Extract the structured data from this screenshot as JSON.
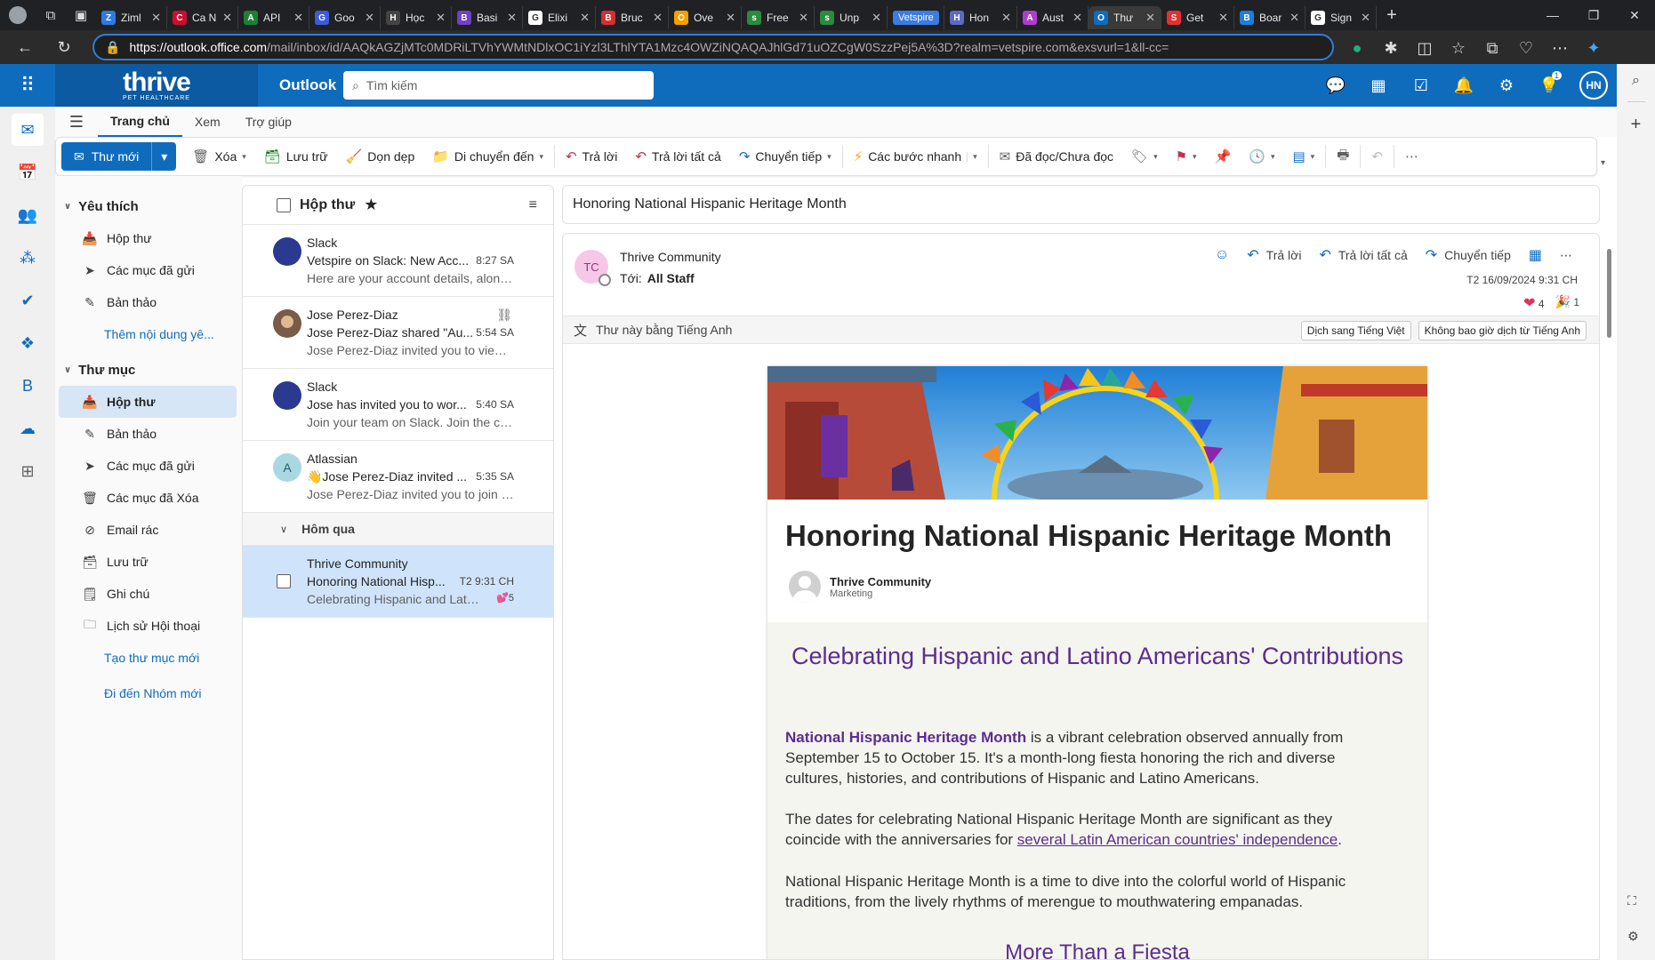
{
  "browser": {
    "tabs": [
      {
        "label": "Ziml",
        "color": "#2d7be0",
        "glyph": "Z"
      },
      {
        "label": "Ca N",
        "color": "#c8102e",
        "glyph": "C"
      },
      {
        "label": "API",
        "color": "#1e7e34",
        "glyph": "A"
      },
      {
        "label": "Goo",
        "color": "#3b5bdb",
        "glyph": "G"
      },
      {
        "label": "Học",
        "color": "#444",
        "glyph": "H"
      },
      {
        "label": "Basi",
        "color": "#6f42c1",
        "glyph": "B"
      },
      {
        "label": "Elixi",
        "color": "#fff",
        "glyph": "G"
      },
      {
        "label": "Bruc",
        "color": "#d32f2f",
        "glyph": "B"
      },
      {
        "label": "Ove",
        "color": "#f59f00",
        "glyph": "O"
      },
      {
        "label": "Free",
        "color": "#2b8a3e",
        "glyph": "s"
      },
      {
        "label": "Unp",
        "color": "#2b8a3e",
        "glyph": "s"
      },
      {
        "label": "Vetspire",
        "color": "#3b7ce0",
        "glyph": "Vetspire",
        "pill": true
      },
      {
        "label": "Hon",
        "color": "#5c6bc0",
        "glyph": "H"
      },
      {
        "label": "Aust",
        "color": "#ae3ec9",
        "glyph": "A"
      },
      {
        "label": "Thư",
        "color": "#0f6cbd",
        "glyph": "O",
        "active": true
      },
      {
        "label": "Get",
        "color": "#e03131",
        "glyph": "S"
      },
      {
        "label": "Boar",
        "color": "#1c7ed6",
        "glyph": "B"
      },
      {
        "label": "Sign",
        "color": "#fff",
        "glyph": "G"
      }
    ],
    "url_host": "https://outlook.office.com",
    "url_rest": "/mail/inbox/id/AAQkAGZjMTc0MDRiLTVhYWMtNDlxOC1iYzl3LThlYTA1Mzc4OWZiNQAQAJhlGd71uOZCgW0SzzPej5A%3D?realm=vetspire.com&exsvurl=1&ll-cc="
  },
  "header": {
    "brand": "thrive",
    "brand_sub": "PET HEALTHCARE",
    "app": "Outlook",
    "search_placeholder": "Tìm kiếm",
    "avatar": "HN",
    "badge": "1"
  },
  "ribbon": {
    "tabs": [
      "Trang chủ",
      "Xem",
      "Trợ giúp"
    ],
    "new_mail": "Thư mới",
    "delete": "Xóa",
    "archive": "Lưu trữ",
    "sweep": "Dọn dẹp",
    "move": "Di chuyển đến",
    "reply": "Trả lời",
    "reply_all": "Trả lời tất cả",
    "forward": "Chuyển tiếp",
    "quick_steps": "Các bước nhanh",
    "read_unread": "Đã đọc/Chưa đọc"
  },
  "folders": {
    "favorites_title": "Yêu thích",
    "favorites": [
      "Hộp thư",
      "Các mục đã gửi",
      "Bản thảo"
    ],
    "favorites_add": "Thêm nội dung yê...",
    "folders_title": "Thư mục",
    "items": [
      "Hộp thư",
      "Bản thảo",
      "Các mục đã gửi",
      "Các mục đã Xóa",
      "Email rác",
      "Lưu trữ",
      "Ghi chú",
      "Lịch sử Hội thoại"
    ],
    "new_folder": "Tạo thư mục mới",
    "new_group": "Đi đến Nhóm mới"
  },
  "messagelist": {
    "title": "Hộp thư",
    "messages": [
      {
        "sender": "Slack",
        "subject": "Vetspire on Slack: New Acc...",
        "time": "8:27 SA",
        "preview": "Here are your account details, along..."
      },
      {
        "sender": "Jose Perez-Diaz",
        "subject": "Jose Perez-Diaz shared \"Au...",
        "time": "5:54 SA",
        "preview": "Jose Perez-Diaz invited you to view ..."
      },
      {
        "sender": "Slack",
        "subject": "Jose has invited you to wor...",
        "time": "5:40 SA",
        "preview": "Join your team on Slack. Join the co..."
      },
      {
        "sender": "Atlassian",
        "avatar": "A",
        "subject": "👋Jose Perez-Diaz invited ...",
        "time": "5:35 SA",
        "preview": "Jose Perez-Diaz invited you to join t..."
      }
    ],
    "group": "Hôm qua",
    "selected": {
      "sender": "Thrive Community",
      "subject": "Honoring National Hisp...",
      "time": "T2 9:31 CH",
      "preview": "Celebrating Hispanic and Latin...",
      "reactions": "5"
    }
  },
  "reading": {
    "subject": "Honoring National Hispanic Heritage Month",
    "avatar": "TC",
    "from": "Thrive Community",
    "to_label": "Tới:",
    "to": "All Staff",
    "reply": "Trả lời",
    "reply_all": "Trả lời tất cả",
    "forward": "Chuyển tiếp",
    "date": "T2 16/09/2024 9:31 CH",
    "heart_count": "4",
    "party_count": "1",
    "translate_msg": "Thư này bằng Tiếng Anh",
    "translate_btn": "Dịch sang Tiếng Việt",
    "never_translate_btn": "Không bao giờ dịch từ Tiếng Anh"
  },
  "article": {
    "title": "Honoring National Hispanic Heritage Month",
    "author": "Thrive Community",
    "role": "Marketing",
    "heading": "Celebrating Hispanic and Latino Americans' Contributions",
    "p1_hl": "National Hispanic Heritage Month",
    "p1": " is a vibrant celebration observed annually from September 15 to October 15. It's a month-long fiesta honoring the rich and diverse cultures, histories, and contributions of Hispanic and Latino Americans.",
    "p2": "The dates for celebrating National Hispanic Heritage Month are significant as they coincide with the anniversaries for ",
    "p2_link": "several Latin American countries' independence",
    "p2_end": ".",
    "p3": "National Hispanic Heritage Month is a time to dive into the colorful world of Hispanic traditions, from the lively rhythms of merengue to mouthwatering empanadas.",
    "subheading": "More Than a Fiesta"
  },
  "colors": {
    "brand": "#0f6cbd",
    "accent_purple": "#5b2d8e",
    "selected_row": "#cfe4fa"
  }
}
